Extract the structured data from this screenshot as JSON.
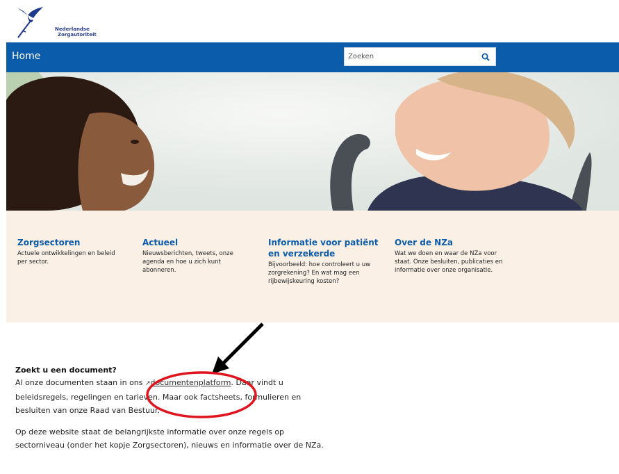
{
  "brand": {
    "logo_line1": "Nederlandse",
    "logo_line2": "Zorgautoriteit"
  },
  "nav": {
    "home_label": "Home",
    "search_placeholder": "Zoeken",
    "search_icon": "search-icon",
    "bar_color": "#0b5cab"
  },
  "cards": [
    {
      "title": "Zorgsectoren",
      "description": "Actuele ontwikkelingen en beleid per sector."
    },
    {
      "title": "Actueel",
      "description": "Nieuwsberichten, tweets, onze agenda en hoe u zich kunt abonneren."
    },
    {
      "title": "Informatie voor patiënt en verzekerde",
      "description": "Bijvoorbeeld: hoe controleert u uw zorgrekening? En wat mag een rijbewijskeuring kosten?"
    },
    {
      "title": "Over de NZa",
      "description": "Wat we doen en waar de NZa voor staat. Onze besluiten, publicaties en informatie over onze organisatie."
    }
  ],
  "content": {
    "heading": "Zoekt u een document?",
    "p1_before": "Al onze documenten staan in ons ",
    "link_text": "documentenplatform",
    "p1_after": ". Daar vindt u beleidsregels, regelingen en tarieven. Maar ook factsheets, formulieren en besluiten van onze Raad van Bestuur.",
    "p2": "Op deze website staat de belangrijkste informatie over onze regels op sectorniveau (onder het kopje Zorgsectoren), nieuws en informatie over de NZa."
  },
  "colors": {
    "accent": "#0b5cab",
    "cards_background": "#fbf0e6",
    "annotation_red": "#e0141e"
  }
}
